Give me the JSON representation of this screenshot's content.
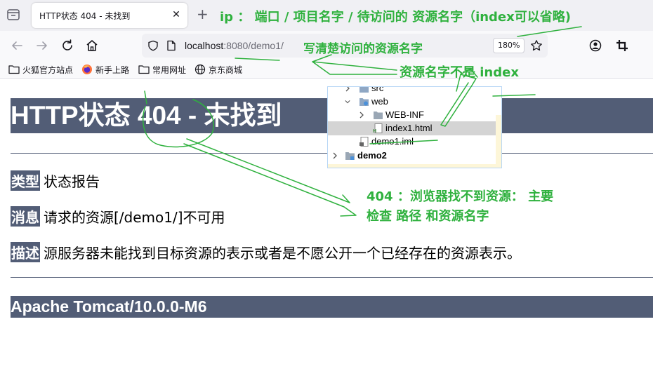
{
  "browser": {
    "tab_title": "HTTP状态 404 - 未找到",
    "tab_close": "✕",
    "new_tab": "+",
    "url_host": "localhost",
    "url_rest": ":8080/demo1/",
    "zoom": "180%",
    "bookmarks": [
      {
        "label": "火狐官方站点",
        "icon": "folder-icon"
      },
      {
        "label": "新手上路",
        "icon": "firefox-icon"
      },
      {
        "label": "常用网址",
        "icon": "folder-icon"
      },
      {
        "label": "京东商城",
        "icon": "globe-icon"
      }
    ]
  },
  "error_page": {
    "title": "HTTP状态 404 - 未找到",
    "type_label": "类型",
    "type_value": "状态报告",
    "message_label": "消息",
    "message_value": "请求的资源[/demo1/]不可用",
    "desc_label": "描述",
    "desc_value": "源服务器未能找到目标资源的表示或者是不愿公开一个已经存在的资源表示。",
    "footer": "Apache Tomcat/10.0.0-M6"
  },
  "project_tree": {
    "items": [
      {
        "label": "src",
        "icon": "folder-icon",
        "expanded": false
      },
      {
        "label": "web",
        "icon": "web-folder-icon",
        "expanded": true
      },
      {
        "label": "WEB-INF",
        "icon": "folder-icon",
        "expanded": false
      },
      {
        "label": "index1.html",
        "icon": "html-file-icon",
        "selected": true
      },
      {
        "label": "demo1.iml",
        "icon": "iml-file-icon"
      },
      {
        "label": "demo2",
        "icon": "module-icon",
        "expanded": false
      }
    ]
  },
  "annotations": {
    "url_format": "ip ：  端口  /  项目名字  / 待访问的   资源名字（index可以省略)",
    "url_hint": "写清楚访问的资源名字",
    "resource_hint": "资源名字不是  index",
    "error_hint_line1": "404  ：浏览器找不到资源：   主要",
    "error_hint_line2": "检查 路径 和资源名字",
    "accent_color": "#2fb13e"
  }
}
